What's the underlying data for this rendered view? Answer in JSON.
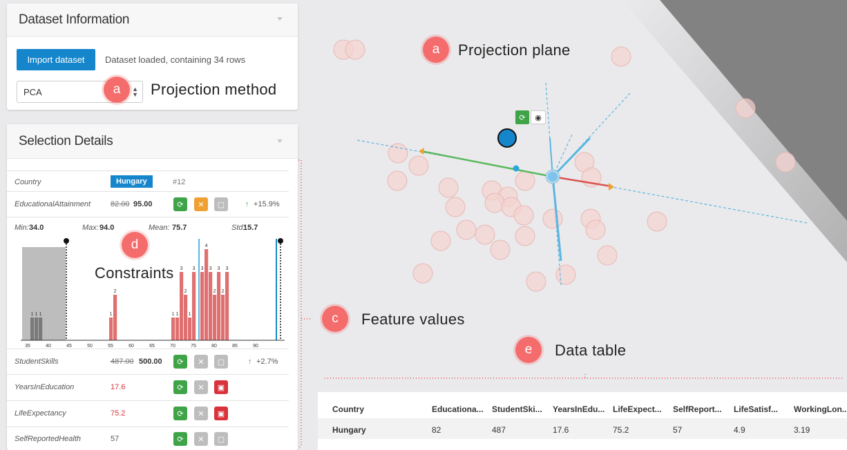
{
  "dataset_panel": {
    "title": "Dataset Information",
    "import_button": "Import dataset",
    "loaded_text": "Dataset loaded, containing 34 rows",
    "projection_method": "PCA"
  },
  "selection_panel": {
    "title": "Selection Details",
    "country_label": "Country",
    "country_value": "Hungary",
    "row_index": "#12",
    "features": [
      {
        "name": "EducationalAttainment",
        "old": "82.00",
        "new": "95.00",
        "change": "+15.9%"
      },
      {
        "name": "StudentSkills",
        "old": "487.00",
        "new": "500.00",
        "change": "+2.7%"
      },
      {
        "name": "YearsInEducation",
        "value": "17.6"
      },
      {
        "name": "LifeExpectancy",
        "value": "75.2"
      },
      {
        "name": "SelfReportedHealth",
        "value": "57"
      }
    ],
    "stats": {
      "min_label": "Min:",
      "min": "34.0",
      "max_label": "Max:",
      "max": "94.0",
      "mean_label": "Mean:",
      "mean": "75.7",
      "std_label": "Std:",
      "std": "15.7"
    }
  },
  "annotations": {
    "projection_plane": {
      "badge": "a",
      "text": "Projection plane"
    },
    "projection_method": {
      "badge": "a",
      "text": "Projection method"
    },
    "constraints": {
      "badge": "d",
      "text": "Constraints"
    },
    "feature_values": {
      "badge": "c",
      "text": "Feature values"
    },
    "data_table": {
      "badge": "e",
      "text": "Data table"
    }
  },
  "histogram": {
    "bins": [
      36,
      37,
      38,
      55,
      56,
      70,
      71,
      72,
      73,
      74,
      75,
      76,
      77,
      78,
      79,
      80,
      81,
      82,
      83,
      84,
      85,
      86,
      87,
      88,
      89,
      90,
      91,
      92,
      93
    ],
    "counts": [
      1,
      1,
      1,
      1,
      2,
      1,
      1,
      3,
      2,
      1,
      3,
      0,
      3,
      4,
      3,
      2,
      3,
      2,
      3,
      0,
      0,
      0,
      0,
      0,
      0,
      0,
      0,
      0,
      0
    ],
    "tick_labels": [
      "35",
      "40",
      "45",
      "50",
      "55",
      "60",
      "65",
      "70",
      "75",
      "80",
      "85",
      "90"
    ]
  },
  "data_table": {
    "headers": [
      "Country",
      "Educationa...",
      "StudentSki...",
      "YearsInEdu...",
      "LifeExpect...",
      "SelfReport...",
      "LifeSatisf...",
      "WorkingLon..."
    ],
    "rows": [
      [
        "Hungary",
        "82",
        "487",
        "17.6",
        "75.2",
        "57",
        "4.9",
        "3.19"
      ]
    ]
  },
  "colors": {
    "accent": "#1686cc",
    "badge": "#f56c6c",
    "bar": "#e07070",
    "green_axis": "#5cb85c",
    "red_axis": "#d9534f",
    "blue_axis": "#5ab6e0"
  },
  "icons": [
    "refresh-icon",
    "expand-icon",
    "lock-icon",
    "eye-icon",
    "arrow-up-icon",
    "chevron-down-icon"
  ]
}
